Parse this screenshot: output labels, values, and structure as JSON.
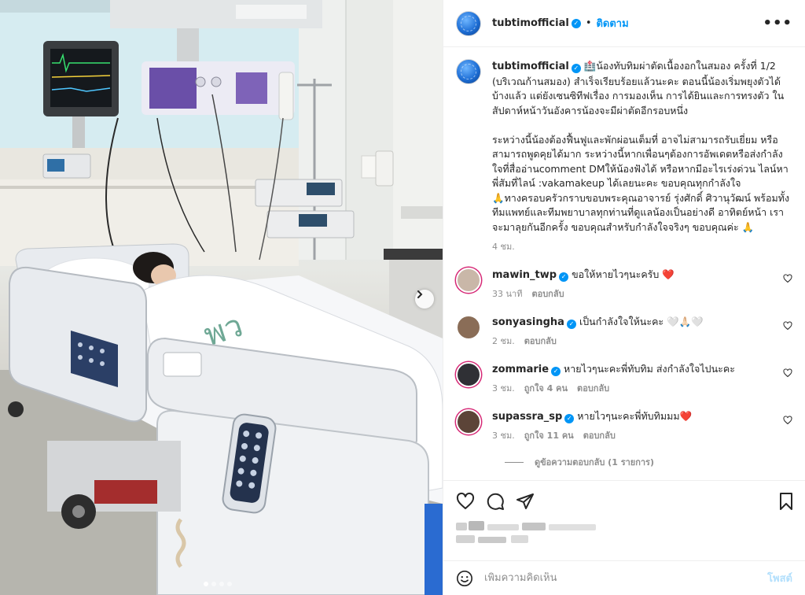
{
  "header": {
    "username": "tubtimofficial",
    "separator": "•",
    "follow_label": "ติดตาม",
    "more_label": "•••"
  },
  "caption": {
    "username": "tubtimofficial",
    "text": "🏥น้องทับทิมผ่าตัดเนื้องอกในสมอง ครั้งที่ 1/2 (บริเวณก้านสมอง) สำเร็จเรียบร้อยแล้วนะคะ ตอนนี้น้องเริ่มพยุงตัวได้บ้างแล้ว แต่ยังเซนซิทีฟเรื่อง การมองเห็น การได้ยินและการทรงตัว ในสัปดาห์หน้าวันอังคารน้องจะมีผ่าตัดอีกรอบหนึ่ง\n\nระหว่างนี้น้องต้องฟื้นฟูและพักผ่อนเต็มที่ อาจไม่สามารถรับเยี่ยม หรือสามารถพูดคุยได้มาก ระหว่างนี้หากเพื่อนๆต้องการอัพเดตหรือส่งกำลังใจที่สื่ออ่านcomment DMให้น้องฟังได้ หรือหากมีอะไรเร่งด่วน ไลน์หาพี่สัมที่ไลน์ :vakamakeup ได้เลยนะคะ ขอบคุณทุกกำลังใจ\n🙏ทางครอบครัวกราบขอบพระคุณอาจารย์ รุ่งศักดิ์ ศิวานุวัฒน์ พร้อมทั้งทีมแพทย์และทีมพยาบาลทุกท่านที่ดูแลน้องเป็นอย่างดี อาทิตย์หน้า เราจะมาลุยกันอีกครั้ง ขอบคุณสำหรับกำลังใจจริงๆ ขอบคุณค่ะ 🙏",
    "time": "4 ชม."
  },
  "comments": [
    {
      "username": "mawin_twp",
      "text": "ขอให้หายไวๆนะครับ ❤️",
      "time": "33 นาที",
      "likes": "",
      "reply_label": "ตอบกลับ"
    },
    {
      "username": "sonyasingha",
      "text": "เป็นกำลังใจให้นะคะ 🤍🙏🏻🤍",
      "time": "2 ชม.",
      "likes": "",
      "reply_label": "ตอบกลับ"
    },
    {
      "username": "zommarie",
      "text": "หายไวๆนะคะพี่ทับทิม ส่งกำลังใจไปนะคะ",
      "time": "3 ชม.",
      "likes": "ถูกใจ 4 คน",
      "reply_label": "ตอบกลับ"
    },
    {
      "username": "supassra_sp",
      "text": "หายไวๆนะคะพี่ทับทิมมม❤️",
      "time": "3 ชม.",
      "likes": "ถูกใจ 11 คน",
      "reply_label": "ตอบกลับ"
    }
  ],
  "view_replies_label": "ดูข้อความตอบกลับ (1 รายการ)",
  "add_comment": {
    "placeholder": "เพิ่มความคิดเห็น",
    "post_label": "โพสต์"
  },
  "carousel": {
    "slides": 4,
    "active": 0
  },
  "colors": {
    "link": "#0095f6",
    "muted": "#8e8e8e",
    "text": "#262626",
    "post_disabled": "#b2dffc",
    "heart_red": "#ed4956"
  }
}
